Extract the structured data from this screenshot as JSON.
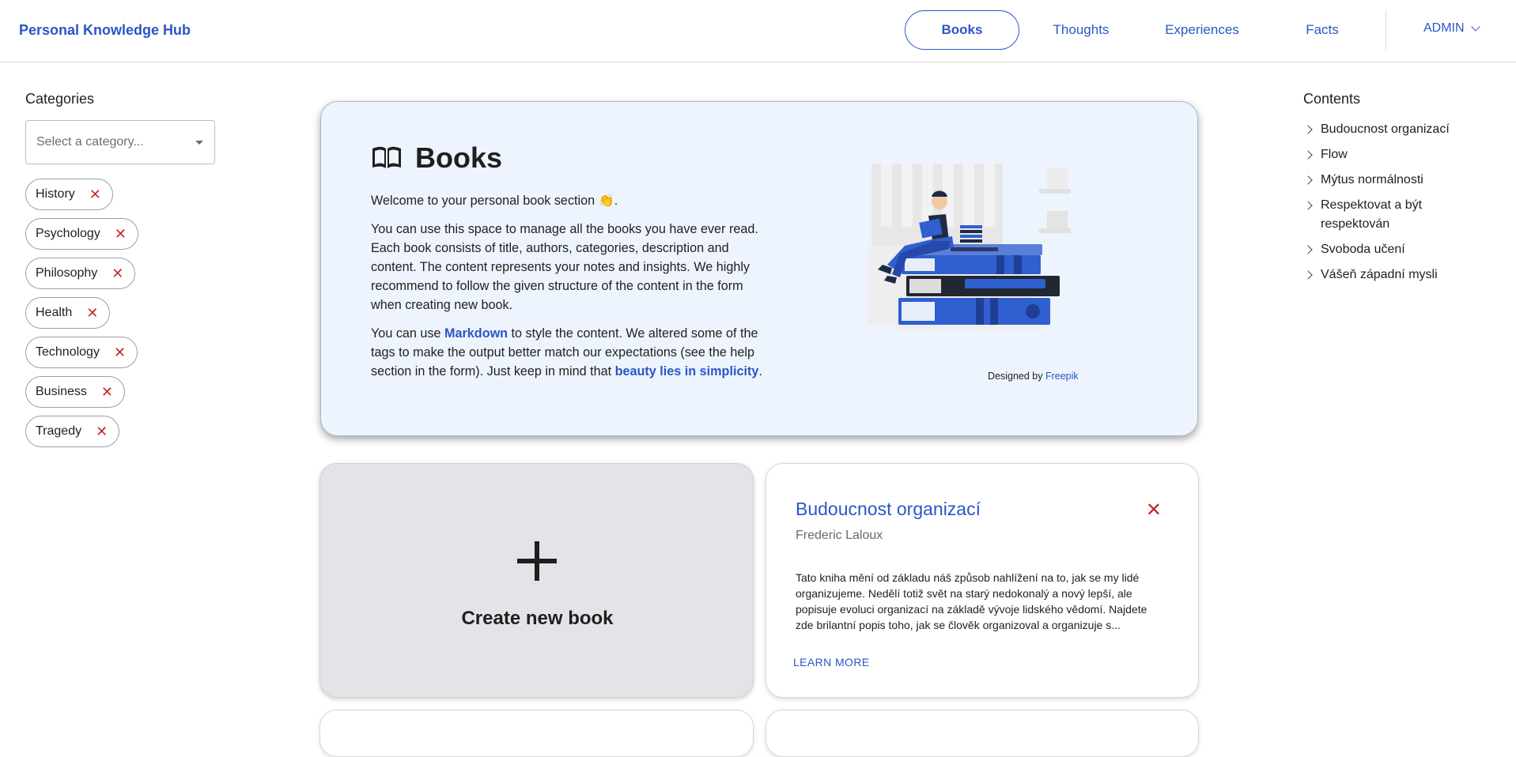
{
  "header": {
    "brand": "Personal Knowledge Hub",
    "nav": [
      "Books",
      "Thoughts",
      "Experiences",
      "Facts"
    ],
    "active_nav": "Books",
    "user": "ADMIN"
  },
  "categories": {
    "title": "Categories",
    "placeholder": "Select a category...",
    "chips": [
      "History",
      "Psychology",
      "Philosophy",
      "Health",
      "Technology",
      "Business",
      "Tragedy"
    ]
  },
  "hero": {
    "title": "Books",
    "p1": "Welcome to your personal book section 👏.",
    "p2": "You can use this space to manage all the books you have ever read. Each book consists of title, authors, categories, description and content. The content represents your notes and insights. We highly recommend to follow the given structure of the content in the form when creating new book.",
    "p3_before": "You can use ",
    "p3_link1": "Markdown",
    "p3_middle": " to style the content. We altered some of the tags to make the output better match our expectations (see the help section in the form). Just keep in mind that ",
    "p3_link2": "beauty lies in simplicity",
    "p3_after": ".",
    "credit_prefix": "Designed by ",
    "credit_link": "Freepik"
  },
  "create": {
    "label": "Create new book"
  },
  "book_card": {
    "title": "Budoucnost organizací",
    "author": "Frederic Laloux",
    "description": "Tato kniha mění od základu náš způsob nahlížení na to, jak se my lidé organizujeme. Nedělí totiž svět na starý nedokonalý a nový lepší, ale popisuje evoluci organizací na základě vývoje lidského vědomí. Najdete zde brilantní popis toho, jak se člověk organizoval a organizuje s...",
    "more": "LEARN MORE"
  },
  "contents": {
    "title": "Contents",
    "items": [
      "Budoucnost organizací",
      "Flow",
      "Mýtus normálnosti",
      "Respektovat a být respektován",
      "Svoboda učení",
      "Vášeň západní mysli"
    ]
  },
  "colors": {
    "accent": "#2a56c6",
    "danger": "#c62828",
    "hero_bg": "#eef4fd"
  },
  "icons": {
    "hero": "open-book-icon",
    "chip_remove": "close-icon",
    "toc": "chevron-right-icon"
  }
}
